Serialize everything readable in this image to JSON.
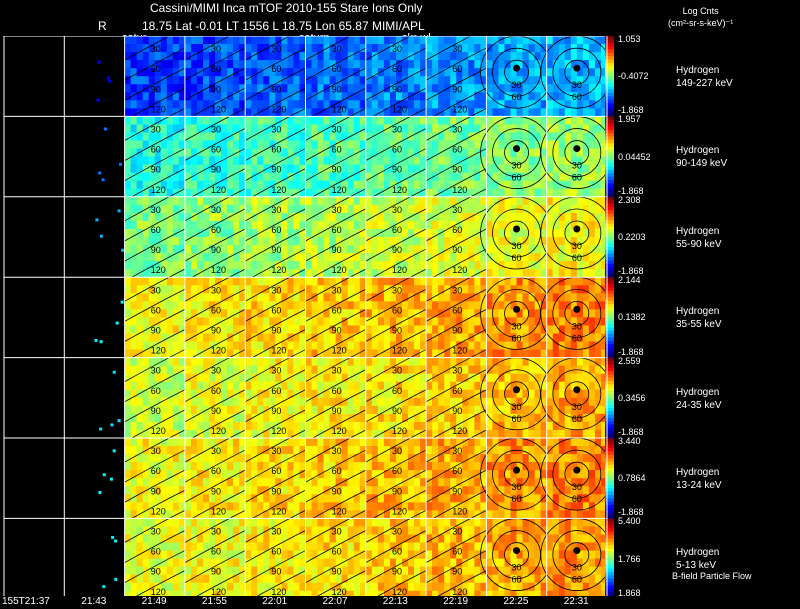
{
  "header": {
    "title": "Cassini/MIMI Inca mTOF  2010-155   Stare    Ions Only",
    "r_label": "R",
    "info_line": "18.75 Lat -0.01 LT 1556 L          18.75 Lon         65.87  MIMI/APL",
    "units_line1": "Log Cnts",
    "units_line2": "(cm²-sr-s-keV)⁻¹"
  },
  "panel_labels": {
    "saturn_a": "satur",
    "saturn_b": "saturn",
    "skr": "skr-wl"
  },
  "footer": {
    "bfield": "B-field Particle Flow"
  },
  "chart_data": {
    "type": "heatmap",
    "title": "Cassini/MIMI Inca mTOF  2010-155   Stare    Ions Only",
    "time_labels": [
      "155T21:37",
      "21:43",
      "21:49",
      "21:55",
      "22:01",
      "22:07",
      "22:13",
      "22:19",
      "22:25",
      "22:31"
    ],
    "contour_labels": [
      "30",
      "60",
      "90",
      "120"
    ],
    "rows": [
      {
        "species": "Hydrogen",
        "energy": "149-227 keV",
        "cb_max": "1.053",
        "cb_mid": "-0.4072",
        "cb_min": "-1.868",
        "level": 0.18
      },
      {
        "species": "Hydrogen",
        "energy": "90-149 keV",
        "cb_max": "1.957",
        "cb_mid": "0.04452",
        "cb_min": "-1.868",
        "level": 0.4
      },
      {
        "species": "Hydrogen",
        "energy": "55-90 keV",
        "cb_max": "2.308",
        "cb_mid": "0.2203",
        "cb_min": "-1.868",
        "level": 0.5
      },
      {
        "species": "Hydrogen",
        "energy": "35-55 keV",
        "cb_max": "2.144",
        "cb_mid": "0.1382",
        "cb_min": "-1.868",
        "level": 0.62
      },
      {
        "species": "Hydrogen",
        "energy": "24-35 keV",
        "cb_max": "2.559",
        "cb_mid": "0.3456",
        "cb_min": "-1.868",
        "level": 0.58
      },
      {
        "species": "Hydrogen",
        "energy": "13-24 keV",
        "cb_max": "3.440",
        "cb_mid": "0.7864",
        "cb_min": "-1.868",
        "level": 0.62
      },
      {
        "species": "Hydrogen",
        "energy": "5-13 keV",
        "cb_max": "5.400",
        "cb_mid": "1.766",
        "cb_min": "1.868",
        "level": 0.6
      }
    ]
  }
}
